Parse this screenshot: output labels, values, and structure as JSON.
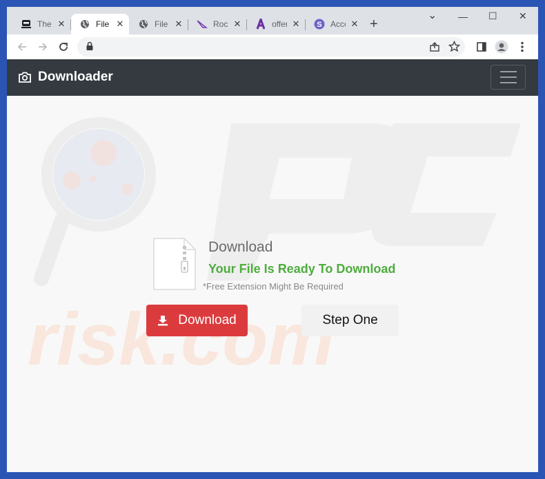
{
  "browser": {
    "tabs": [
      {
        "title": "The H",
        "icon": "ninja-favicon-icon",
        "active": false
      },
      {
        "title": "File D",
        "icon": "globe-icon",
        "active": true
      },
      {
        "title": "File D",
        "icon": "globe-icon",
        "active": false
      },
      {
        "title": "Rock",
        "icon": "rocket-favicon-icon",
        "active": false
      },
      {
        "title": "offer",
        "icon": "a-letter-favicon-icon",
        "active": false
      },
      {
        "title": "Acce",
        "icon": "s-circle-favicon-icon",
        "active": false
      }
    ],
    "close_glyph": "✕",
    "new_tab_glyph": "+",
    "window_controls": {
      "chevron": "⌄",
      "minimize": "—",
      "maximize": "☐",
      "close": "✕"
    }
  },
  "navbar": {
    "brand": "Downloader",
    "brand_icon": "camera-icon",
    "color": "#343a40"
  },
  "watermark": {
    "text": "PC risk.com"
  },
  "content": {
    "heading": "Download",
    "ready_text": "Your File Is Ready To Download",
    "note": "*Free Extension Might Be Required",
    "download_button": "Download",
    "step_button": "Step One"
  },
  "colors": {
    "accent_green": "#4eac3e",
    "download_red": "#dc3b3e",
    "frame_blue": "#2b55b5"
  }
}
